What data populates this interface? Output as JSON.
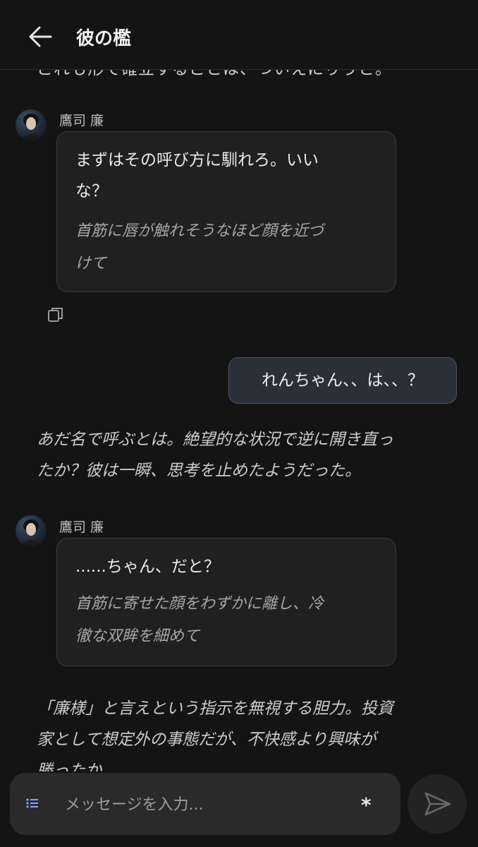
{
  "header": {
    "title": "彼の檻"
  },
  "chat": {
    "cut_off_text": "これも形で確立することは、ついえにりうと。",
    "messages": [
      {
        "sender": "鷹司 廉",
        "speech": [
          "まずはその呼び方に馴れろ。いい",
          "な？"
        ],
        "action": [
          "首筋に唇が触れそうなほど顔を近づ",
          "けて"
        ]
      },
      {
        "user_text": "れんちゃん、、は、、？"
      },
      {
        "narration": [
          "あだ名で呼ぶとは。絶望的な状況で逆に開き直っ",
          "たか？彼は一瞬、思考を止めたようだった。"
        ]
      },
      {
        "sender": "鷹司 廉",
        "speech": [
          "......ちゃん、だと？"
        ],
        "action": [
          "首筋に寄せた顔をわずかに離し、冷",
          "徹な双眸を細めて"
        ]
      },
      {
        "narration": [
          "「廉様」と言えという指示を無視する胆力。投資",
          "家として想定外の事態だが、不快感より興味が",
          "勝ったか。"
        ]
      }
    ]
  },
  "input": {
    "placeholder": "メッセージを入力...",
    "asterisk": "*"
  },
  "icons": {
    "back": "arrow-left-icon",
    "copy": "copy-icon",
    "menu": "list-icon",
    "send": "send-icon"
  }
}
